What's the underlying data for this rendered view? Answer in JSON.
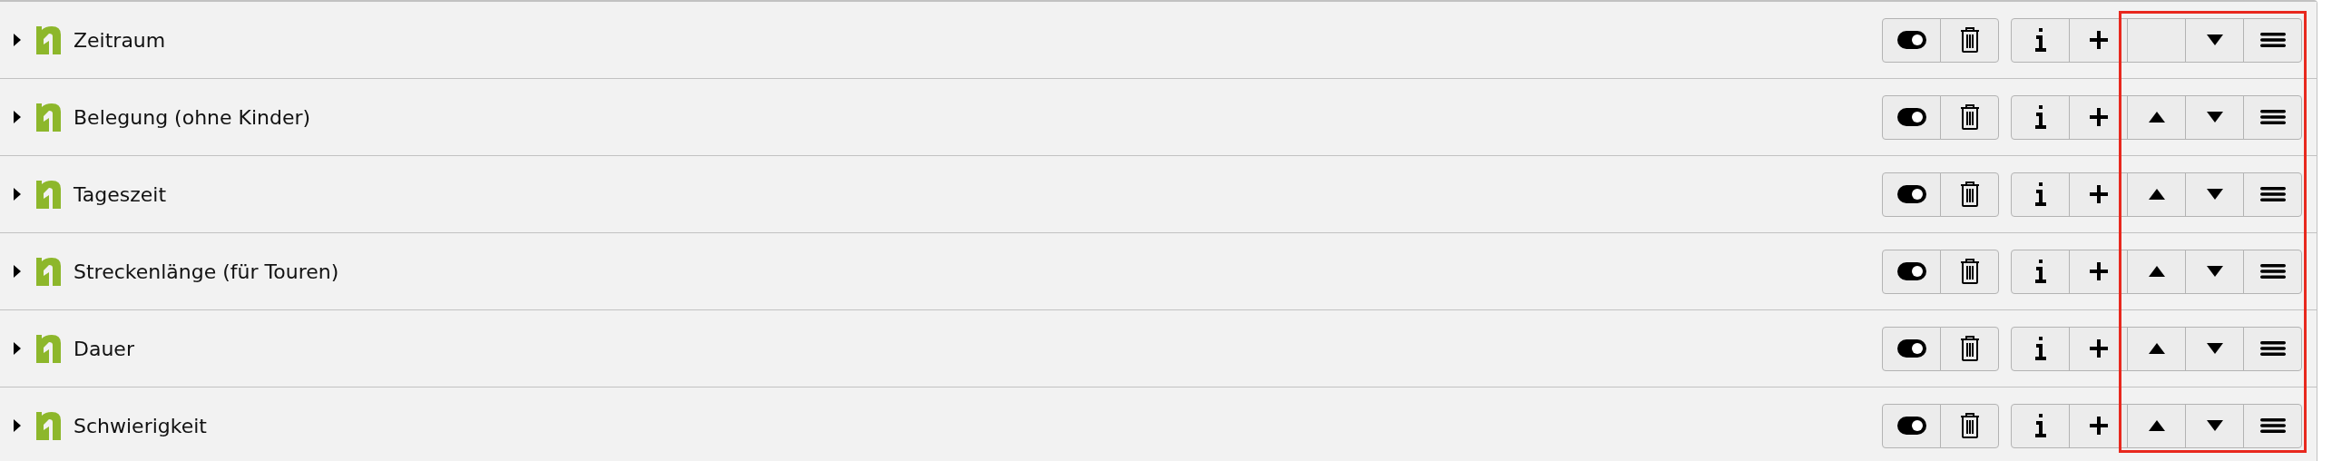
{
  "rows": [
    {
      "title": "Zeitraum",
      "can_move_up": false
    },
    {
      "title": "Belegung (ohne Kinder)",
      "can_move_up": true
    },
    {
      "title": "Tageszeit",
      "can_move_up": true
    },
    {
      "title": "Streckenlänge (für Touren)",
      "can_move_up": true
    },
    {
      "title": "Dauer",
      "can_move_up": true
    },
    {
      "title": "Schwierigkeit",
      "can_move_up": true
    }
  ]
}
